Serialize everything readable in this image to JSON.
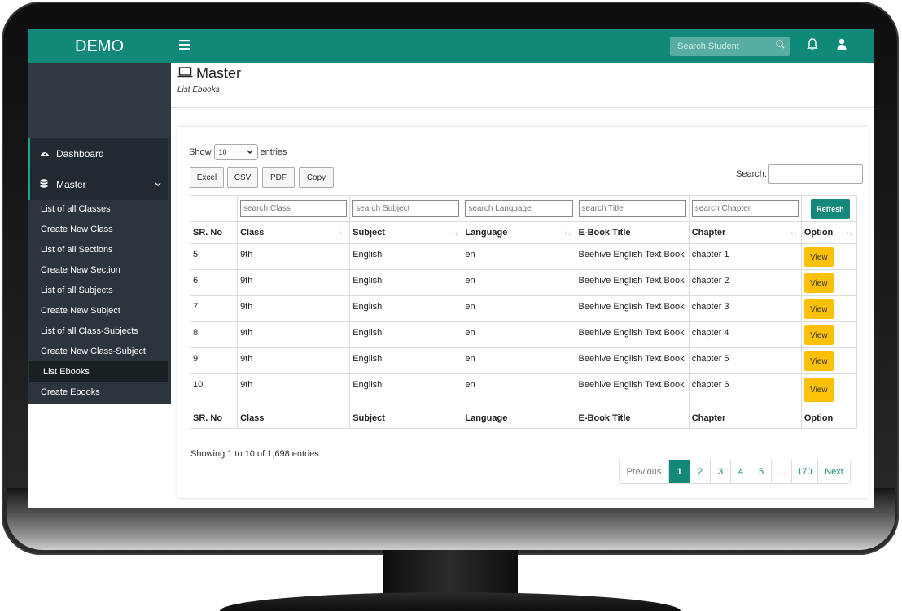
{
  "brand": "DEMO",
  "colors": {
    "primary": "#10897a",
    "sidebar": "#2b353d",
    "view_button": "#fec107"
  },
  "topbar": {
    "menu_icon": "hamburger-icon",
    "search_placeholder": "Search Student",
    "bell_icon": "bell-icon",
    "user_icon": "user-icon"
  },
  "sidebar": {
    "dashboard": "Dashboard",
    "master": "Master",
    "items": [
      "List of all Classes",
      "Create New Class",
      "List of all Sections",
      "Create New Section",
      "List of all Subjects",
      "Create New Subject",
      "List of all Class-Subjects",
      "Create New Class-Subject",
      "List Ebooks",
      "Create Ebooks"
    ],
    "active_item": "List Ebooks"
  },
  "page": {
    "title": "Master",
    "subtitle": "List Ebooks"
  },
  "controls": {
    "show": "Show",
    "entries": "entries",
    "page_size": "10",
    "buttons": {
      "excel": "Excel",
      "csv": "CSV",
      "pdf": "PDF",
      "copy": "Copy"
    },
    "search_label": "Search:"
  },
  "filters": {
    "class": "search Class",
    "subject": "search Subject",
    "language": "search Language",
    "title": "search Title",
    "chapter": "search Chapter",
    "refresh": "Refresh"
  },
  "columns": [
    "SR. No",
    "Class",
    "Subject",
    "Language",
    "E-Book Title",
    "Chapter",
    "Option"
  ],
  "rows": [
    {
      "sr": "5",
      "class": "9th",
      "subject": "English",
      "language": "en",
      "title": "Beehive English Text Book",
      "chapter": "chapter 1",
      "option": "View"
    },
    {
      "sr": "6",
      "class": "9th",
      "subject": "English",
      "language": "en",
      "title": "Beehive English Text Book",
      "chapter": "chapter 2",
      "option": "View"
    },
    {
      "sr": "7",
      "class": "9th",
      "subject": "English",
      "language": "en",
      "title": "Beehive English Text Book",
      "chapter": "chapter 3",
      "option": "View"
    },
    {
      "sr": "8",
      "class": "9th",
      "subject": "English",
      "language": "en",
      "title": "Beehive English Text Book",
      "chapter": "chapter 4",
      "option": "View"
    },
    {
      "sr": "9",
      "class": "9th",
      "subject": "English",
      "language": "en",
      "title": "Beehive English Text Book",
      "chapter": "chapter 5",
      "option": "View"
    },
    {
      "sr": "10",
      "class": "9th",
      "subject": "English",
      "language": "en",
      "title": "Beehive English Text Book",
      "chapter": "chapter 6",
      "option": "View"
    }
  ],
  "info": "Showing 1 to 10 of 1,698 entries",
  "pagination": {
    "previous": "Previous",
    "pages": [
      "1",
      "2",
      "3",
      "4",
      "5",
      "…",
      "170"
    ],
    "current": "1",
    "next": "Next"
  }
}
